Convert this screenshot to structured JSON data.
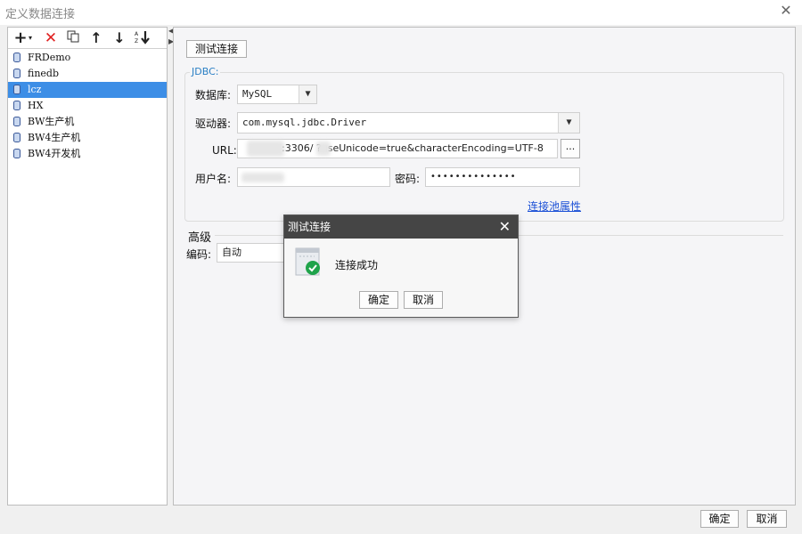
{
  "window": {
    "title": "定义数据连接"
  },
  "left": {
    "connections": [
      {
        "name": "FRDemo",
        "selected": false
      },
      {
        "name": "finedb",
        "selected": false
      },
      {
        "name": "lcz",
        "selected": true
      },
      {
        "name": "HX",
        "selected": false
      },
      {
        "name": "BW生产机",
        "selected": false
      },
      {
        "name": "BW4生产机",
        "selected": false
      },
      {
        "name": "BW4开发机",
        "selected": false
      }
    ]
  },
  "right": {
    "test_button": "测试连接",
    "group_title": "JDBC:",
    "database_label": "数据库:",
    "database_value": "MySQL",
    "driver_label": "驱动器:",
    "driver_value": "com.mysql.jdbc.Driver",
    "url_label": "URL:",
    "url_value": ":3306/    ?useUnicode=true&characterEncoding=UTF-8",
    "url_browse": "...",
    "user_label": "用户名:",
    "password_label": "密码:",
    "password_value": "••••••••••••••",
    "pool_link": "连接池属性",
    "advanced_title": "高级",
    "encoding_label": "编码:",
    "encoding_value": "自动"
  },
  "dialog": {
    "title": "测试连接",
    "message": "连接成功",
    "ok": "确定",
    "cancel": "取消"
  },
  "footer": {
    "ok": "确定",
    "cancel": "取消"
  },
  "colors": {
    "selection": "#3d8ee6",
    "link": "#1a4fd6",
    "success": "#1fa34a",
    "dialog_header": "#454545"
  }
}
